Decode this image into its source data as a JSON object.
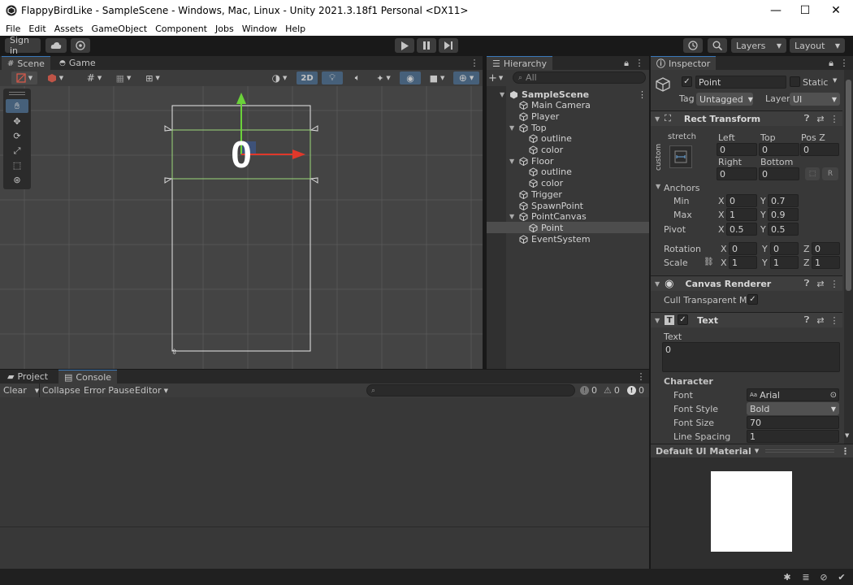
{
  "window": {
    "title": "FlappyBirdLike - SampleScene - Windows, Mac, Linux - Unity 2021.3.18f1 Personal <DX11>",
    "minimize": "—",
    "maximize": "☐",
    "close": "✕"
  },
  "menu": [
    "File",
    "Edit",
    "Assets",
    "GameObject",
    "Component",
    "Jobs",
    "Window",
    "Help"
  ],
  "toolbar": {
    "sign_in": "Sign in",
    "layers": "Layers",
    "layout": "Layout"
  },
  "scene": {
    "tab_scene": "Scene",
    "tab_game": "Game",
    "btn_2d": "2D",
    "point_text": "0"
  },
  "hierarchy": {
    "tab": "Hierarchy",
    "search_placeholder": "All",
    "items": [
      {
        "label": "SampleScene",
        "depth": 0,
        "fold": "open",
        "scene": true
      },
      {
        "label": "Main Camera",
        "depth": 1,
        "fold": ""
      },
      {
        "label": "Player",
        "depth": 1,
        "fold": ""
      },
      {
        "label": "Top",
        "depth": 1,
        "fold": "open"
      },
      {
        "label": "outline",
        "depth": 2,
        "fold": ""
      },
      {
        "label": "color",
        "depth": 2,
        "fold": ""
      },
      {
        "label": "Floor",
        "depth": 1,
        "fold": "open"
      },
      {
        "label": "outline",
        "depth": 2,
        "fold": ""
      },
      {
        "label": "color",
        "depth": 2,
        "fold": ""
      },
      {
        "label": "Trigger",
        "depth": 1,
        "fold": ""
      },
      {
        "label": "SpawnPoint",
        "depth": 1,
        "fold": ""
      },
      {
        "label": "PointCanvas",
        "depth": 1,
        "fold": "open"
      },
      {
        "label": "Point",
        "depth": 2,
        "fold": "",
        "selected": true
      },
      {
        "label": "EventSystem",
        "depth": 1,
        "fold": ""
      }
    ]
  },
  "inspector": {
    "tab": "Inspector",
    "name": "Point",
    "static_label": "Static",
    "tag_label": "Tag",
    "tag_value": "Untagged",
    "layer_label": "Layer",
    "layer_value": "UI",
    "rect_transform": {
      "title": "Rect Transform",
      "stretch": "stretch",
      "custom": "custom",
      "left_label": "Left",
      "left": "0",
      "top_label": "Top",
      "top": "0",
      "posz_label": "Pos Z",
      "posz": "0",
      "right_label": "Right",
      "right": "0",
      "bottom_label": "Bottom",
      "bottom": "0",
      "r_button": "R",
      "anchors": "Anchors",
      "min": "Min",
      "min_x": "0",
      "min_y": "0.7",
      "max": "Max",
      "max_x": "1",
      "max_y": "0.9",
      "pivot": "Pivot",
      "pivot_x": "0.5",
      "pivot_y": "0.5",
      "rotation": "Rotation",
      "rot_x": "0",
      "rot_y": "0",
      "rot_z": "0",
      "scale": "Scale",
      "scale_x": "1",
      "scale_y": "1",
      "scale_z": "1",
      "x": "X",
      "y": "Y",
      "z": "Z"
    },
    "canvas_renderer": {
      "title": "Canvas Renderer",
      "cull": "Cull Transparent Mes"
    },
    "text": {
      "title": "Text",
      "text_label": "Text",
      "text_value": "0",
      "character": "Character",
      "font_label": "Font",
      "font_value": "Arial",
      "font_style_label": "Font Style",
      "font_style_value": "Bold",
      "font_size_label": "Font Size",
      "font_size_value": "70",
      "line_spacing_label": "Line Spacing",
      "line_spacing_value": "1"
    },
    "material": "Default UI Material"
  },
  "bottom": {
    "tab_project": "Project",
    "tab_console": "Console",
    "clear": "Clear",
    "collapse": "Collapse",
    "error_pause": "Error Pause",
    "editor": "Editor",
    "count_log": "0",
    "count_warn": "0",
    "count_err": "0"
  },
  "colors": {
    "accent": "#3a79bb",
    "selection": "#4d4d4d",
    "x_axis": "#e0382b",
    "y_axis": "#6bd23a"
  }
}
